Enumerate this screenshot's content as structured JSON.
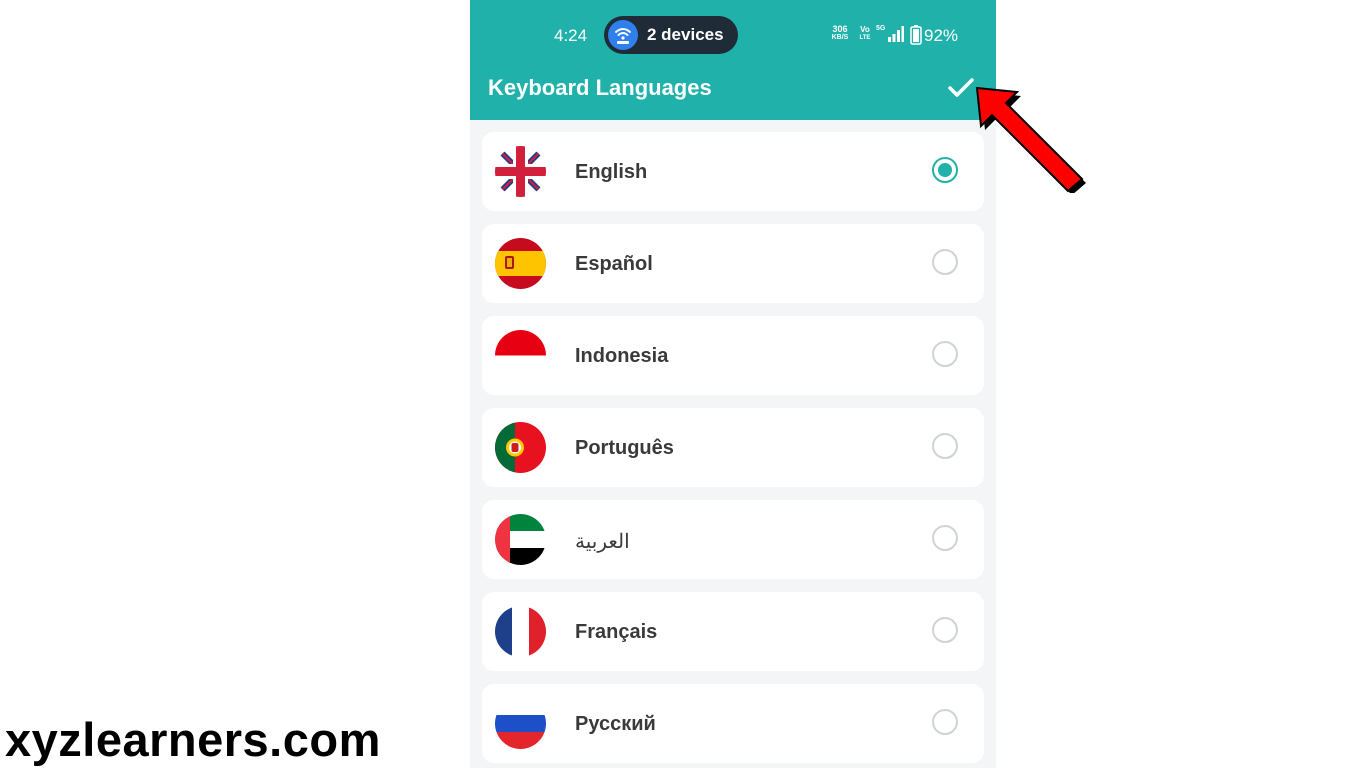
{
  "status_bar": {
    "time": "4:24",
    "hotspot_label": "2 devices",
    "net_speed_value": "306",
    "net_speed_unit": "KB/S",
    "volte_top": "Vo",
    "volte_bottom": "LTE",
    "network_type": "5G",
    "battery": "92%"
  },
  "header": {
    "title": "Keyboard Languages",
    "confirm_icon": "checkmark-icon",
    "background": "#20b2aa"
  },
  "languages": [
    {
      "label": "English",
      "flag": "uk-flag-icon",
      "selected": true
    },
    {
      "label": "Español",
      "flag": "spain-flag-icon",
      "selected": false
    },
    {
      "label": "Indonesia",
      "flag": "indonesia-flag-icon",
      "selected": false
    },
    {
      "label": "Português",
      "flag": "portugal-flag-icon",
      "selected": false
    },
    {
      "label": "العربية",
      "flag": "uae-flag-icon",
      "selected": false
    },
    {
      "label": "Français",
      "flag": "france-flag-icon",
      "selected": false
    },
    {
      "label": "Русский",
      "flag": "russia-flag-icon",
      "selected": false
    }
  ],
  "annotation": {
    "arrow_color": "#ff0000"
  },
  "watermark": "xyzlearners.com"
}
